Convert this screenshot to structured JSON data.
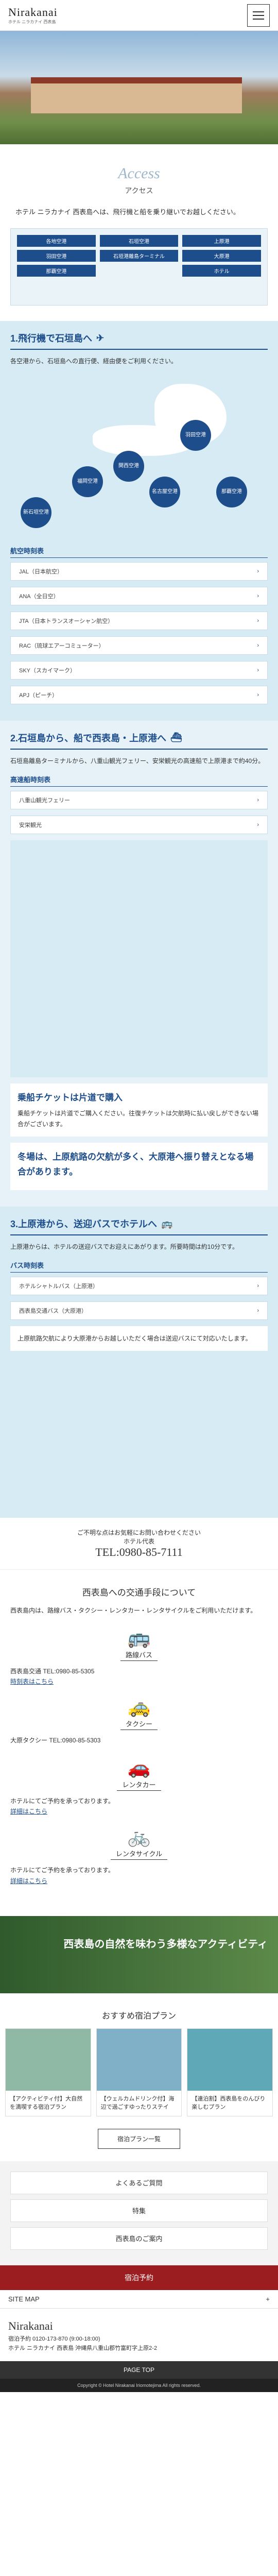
{
  "header": {
    "logo": "Nirakanai",
    "logo_sub": "ホテル ニラカナイ 西表島",
    "menu_label": "MENU"
  },
  "access": {
    "title_en": "Access",
    "title_ja": "アクセス",
    "intro": "ホテル ニラカナイ 西表島へは、飛行機と船を乗り継いでお越しください。"
  },
  "flow": {
    "col1": [
      "各地空港",
      "羽田空港",
      "那覇空港"
    ],
    "col2": [
      "石垣空港",
      "石垣港離島ターミナル"
    ],
    "col3": [
      "上原港",
      "大原港",
      "ホテル"
    ]
  },
  "step1": {
    "title": "1.飛行機で石垣島へ",
    "text": "各空港から、石垣島への直行便、経由便をご利用ください。",
    "cities": [
      "羽田空港",
      "関西空港",
      "名古屋空港",
      "福岡空港",
      "那覇空港",
      "新石垣空港"
    ],
    "list_label": "航空時刻表",
    "routes": [
      "JAL（日本航空）",
      "ANA（全日空）",
      "JTA（日本トランスオーシャン航空）",
      "RAC（琉球エアーコミューター）",
      "SKY（スカイマーク）",
      "APJ（ピーチ）"
    ]
  },
  "step2": {
    "title": "2.石垣島から、船で西表島・上原港へ",
    "text": "石垣島離島ターミナルから、八重山観光フェリー、安栄観光の高速船で上原港まで約40分。",
    "list_label": "高速船時刻表",
    "routes": [
      "八重山観光フェリー",
      "安栄観光"
    ],
    "notice_title": "乗船チケットは片道で購入",
    "notice_text": "乗船チケットは片道でご購入ください。往復チケットは欠航時に払い戻しができない場合がございます。",
    "notice_big": "冬場は、上原航路の欠航が多く、大原港へ振り替えとなる場合があります。"
  },
  "step3": {
    "title": "3.上原港から、送迎バスでホテルへ",
    "text": "上原港からは、ホテルの送迎バスでお迎えにあがります。所要時間は約10分です。",
    "list_label": "バス時刻表",
    "routes": [
      "ホテルシャトルバス（上原港）",
      "西表島交通バス（大原港）"
    ],
    "notice": "上原航路欠航により大原港からお越しいただく場合は送迎バスにて対応いたします。"
  },
  "contact": {
    "label": "ご不明な点はお気軽にお問い合わせください",
    "tel_label": "ホテル代表",
    "tel": "TEL:0980-85-7111"
  },
  "transport": {
    "title": "西表島への交通手段について",
    "desc": "西表島内は、路線バス・タクシー・レンタカー・レンタサイクルをご利用いただけます。",
    "items": [
      {
        "label": "路線バス",
        "text": "西表島交通 TEL:0980-85-5305",
        "link": "時刻表はこちら"
      },
      {
        "label": "タクシー",
        "text": "大原タクシー TEL:0980-85-5303",
        "link": ""
      },
      {
        "label": "レンタカー",
        "text": "ホテルにてご予約を承っております。",
        "link": "詳細はこちら"
      },
      {
        "label": "レンタサイクル",
        "text": "ホテルにてご予約を承っております。",
        "link": "詳細はこちら"
      }
    ]
  },
  "banner": {
    "caption": "西表島の自然を味わう多様なアクティビティ"
  },
  "plans": {
    "title": "おすすめ宿泊プラン",
    "items": [
      {
        "name": "【アクティビティ付】大自然を満喫する宿泊プラン"
      },
      {
        "name": "【ウェルカムドリンク付】海辺で過ごすゆったりステイ"
      },
      {
        "name": "【連泊割】西表島をのんびり楽しむプラン"
      }
    ],
    "more": "宿泊プラン一覧"
  },
  "quick": [
    "よくあるご質問",
    "特集",
    "西表島のご案内"
  ],
  "reserve": "宿泊予約",
  "sitemap": "SITE MAP",
  "footer": {
    "logo": "Nirakanai",
    "reserve_tel": "宿泊予約 0120-173-870 (9:00-18:00)",
    "address": "ホテル ニラカナイ 西表島 沖縄県八重山郡竹富町字上原2-2"
  },
  "page_top": "PAGE TOP",
  "copyright": "Copyright © Hotel Nirakanai Iriomotejima All rights reserved."
}
